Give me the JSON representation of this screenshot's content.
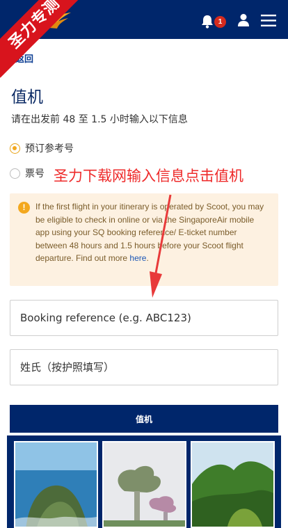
{
  "header": {
    "notification_count": "1",
    "watermark": "圣力专测"
  },
  "nav": {
    "back_label": "返回"
  },
  "page": {
    "title": "值机",
    "subtitle": "请在出发前 48 至 1.5 小时输入以下信息"
  },
  "options": [
    {
      "label": "预订参考号",
      "selected": true
    },
    {
      "label": "票号",
      "selected": false
    }
  ],
  "overlay_annotation": "圣力下载网输入信息点击值机",
  "notice": {
    "text": "If the first flight in your itinerary is operated by Scoot, you may be eligible to check in online or via the SingaporeAir mobile app using your SQ booking reference/ E-ticket number between 48 hours and 1.5 hours before your Scoot flight departure. Find out more ",
    "link": "here",
    "end": "."
  },
  "form": {
    "booking_placeholder": "Booking reference (e.g. ABC123)",
    "surname_placeholder": "姓氏（按护照填写）",
    "submit_label": "值机"
  },
  "colors": {
    "brand_navy": "#00266b",
    "accent_gold": "#f3a81f",
    "notice_bg": "#fdf1e1",
    "annotation_red": "#ee2a2a"
  },
  "icons": [
    "bell-icon",
    "user-icon",
    "menu-icon",
    "info-icon",
    "chevron-left-icon"
  ]
}
